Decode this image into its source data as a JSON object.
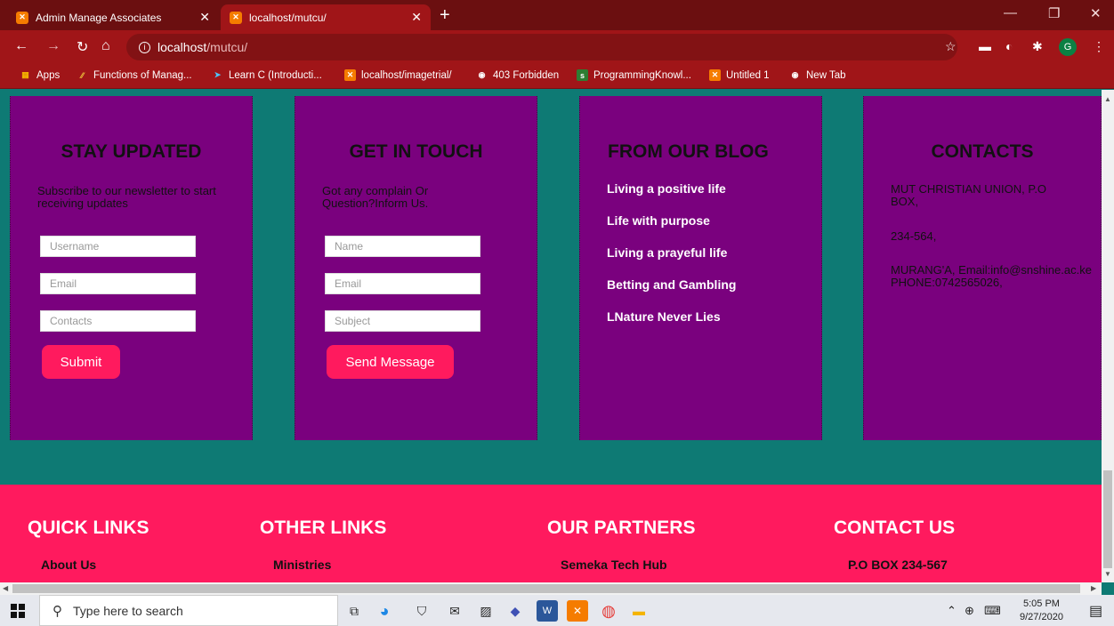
{
  "browser": {
    "tabs": [
      {
        "title": "Admin Manage Associates",
        "active": false
      },
      {
        "title": "localhost/mutcu/",
        "active": true
      }
    ],
    "url_host": "localhost",
    "url_path": "/mutcu/",
    "avatar_letter": "G",
    "bookmarks": [
      {
        "label": "Apps",
        "icon": "apps-grid-icon"
      },
      {
        "label": "Functions of Manag...",
        "icon": "yellow-slash-icon"
      },
      {
        "label": "Learn C (Introducti...",
        "icon": "arrow-icon"
      },
      {
        "label": "localhost/imagetrial/",
        "icon": "xampp-icon"
      },
      {
        "label": "403 Forbidden",
        "icon": "globe-icon"
      },
      {
        "label": "ProgrammingKnowl...",
        "icon": "s-icon"
      },
      {
        "label": "Untitled 1",
        "icon": "xampp-icon"
      },
      {
        "label": "New Tab",
        "icon": "globe-icon"
      }
    ]
  },
  "cards": {
    "stay_updated": {
      "title": "STAY UPDATED",
      "desc": "Subscribe to our newsletter to start receiving updates",
      "placeholders": [
        "Username",
        "Email",
        "Contacts"
      ],
      "button": "Submit"
    },
    "get_in_touch": {
      "title": "GET IN TOUCH",
      "desc": "Got any complain Or Question?Inform Us.",
      "placeholders": [
        "Name",
        "Email",
        "Subject"
      ],
      "button": "Send Message"
    },
    "blog": {
      "title": "FROM OUR BLOG",
      "items": [
        "Living a positive life",
        "Life with purpose",
        "Living a prayeful life",
        "Betting and Gambling",
        "LNature Never Lies"
      ]
    },
    "contacts": {
      "title": "CONTACTS",
      "lines": [
        "MUT CHRISTIAN UNION, P.O BOX,",
        "234-564,",
        "MURANG'A, Email:info@snshine.ac.ke PHONE:0742565026,"
      ]
    }
  },
  "footer": {
    "columns": [
      {
        "heading": "QUICK LINKS",
        "first_link": "About Us"
      },
      {
        "heading": "OTHER LINKS",
        "first_link": "Ministries"
      },
      {
        "heading": "OUR PARTNERS",
        "first_link": "Semeka Tech Hub"
      },
      {
        "heading": "CONTACT US",
        "first_link": "P.O BOX 234-567"
      }
    ]
  },
  "taskbar": {
    "search_placeholder": "Type here to search",
    "time": "5:05 PM",
    "date": "9/27/2020"
  },
  "colors": {
    "page_bg": "#0e7a74",
    "card_bg": "#7a017e",
    "accent": "#ff1a5e",
    "chrome_dark": "#6b0f10",
    "chrome": "#a01518"
  }
}
